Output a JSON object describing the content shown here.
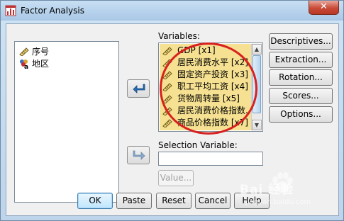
{
  "window": {
    "title": "Factor Analysis",
    "ghost_titles": [
      "",
      "",
      "",
      ""
    ],
    "close_label": "✕"
  },
  "source_list": {
    "items": [
      {
        "label": "序号",
        "icon": "scale-ruler-icon"
      },
      {
        "label": "地区",
        "icon": "nominal-variable-icon"
      }
    ]
  },
  "variables": {
    "label": "Variables:",
    "items": [
      {
        "label": "GDP [x1]"
      },
      {
        "label": "居民消费水平 [x2]"
      },
      {
        "label": "固定资产投资 [x3]"
      },
      {
        "label": "职工平均工资 [x4]"
      },
      {
        "label": "货物周转量 [x5]"
      },
      {
        "label": "居民消费价格指数..."
      },
      {
        "label": "商品价格指数 [x7]"
      }
    ]
  },
  "selection": {
    "label": "Selection Variable:",
    "value": "",
    "value_button": "Value..."
  },
  "side_buttons": {
    "descriptives": "Descriptives...",
    "extraction": "Extraction...",
    "rotation": "Rotation...",
    "scores": "Scores...",
    "options": "Options..."
  },
  "bottom_buttons": {
    "ok": "OK",
    "paste": "Paste",
    "reset": "Reset",
    "cancel": "Cancel",
    "help": "Help"
  },
  "watermark": {
    "brand": "Bai  经验",
    "url": "jingyan.baidu.com"
  },
  "colors": {
    "selection_highlight": "#f5e191",
    "annotation_red": "#d82020",
    "arrow_blue": "#2a6db3"
  }
}
